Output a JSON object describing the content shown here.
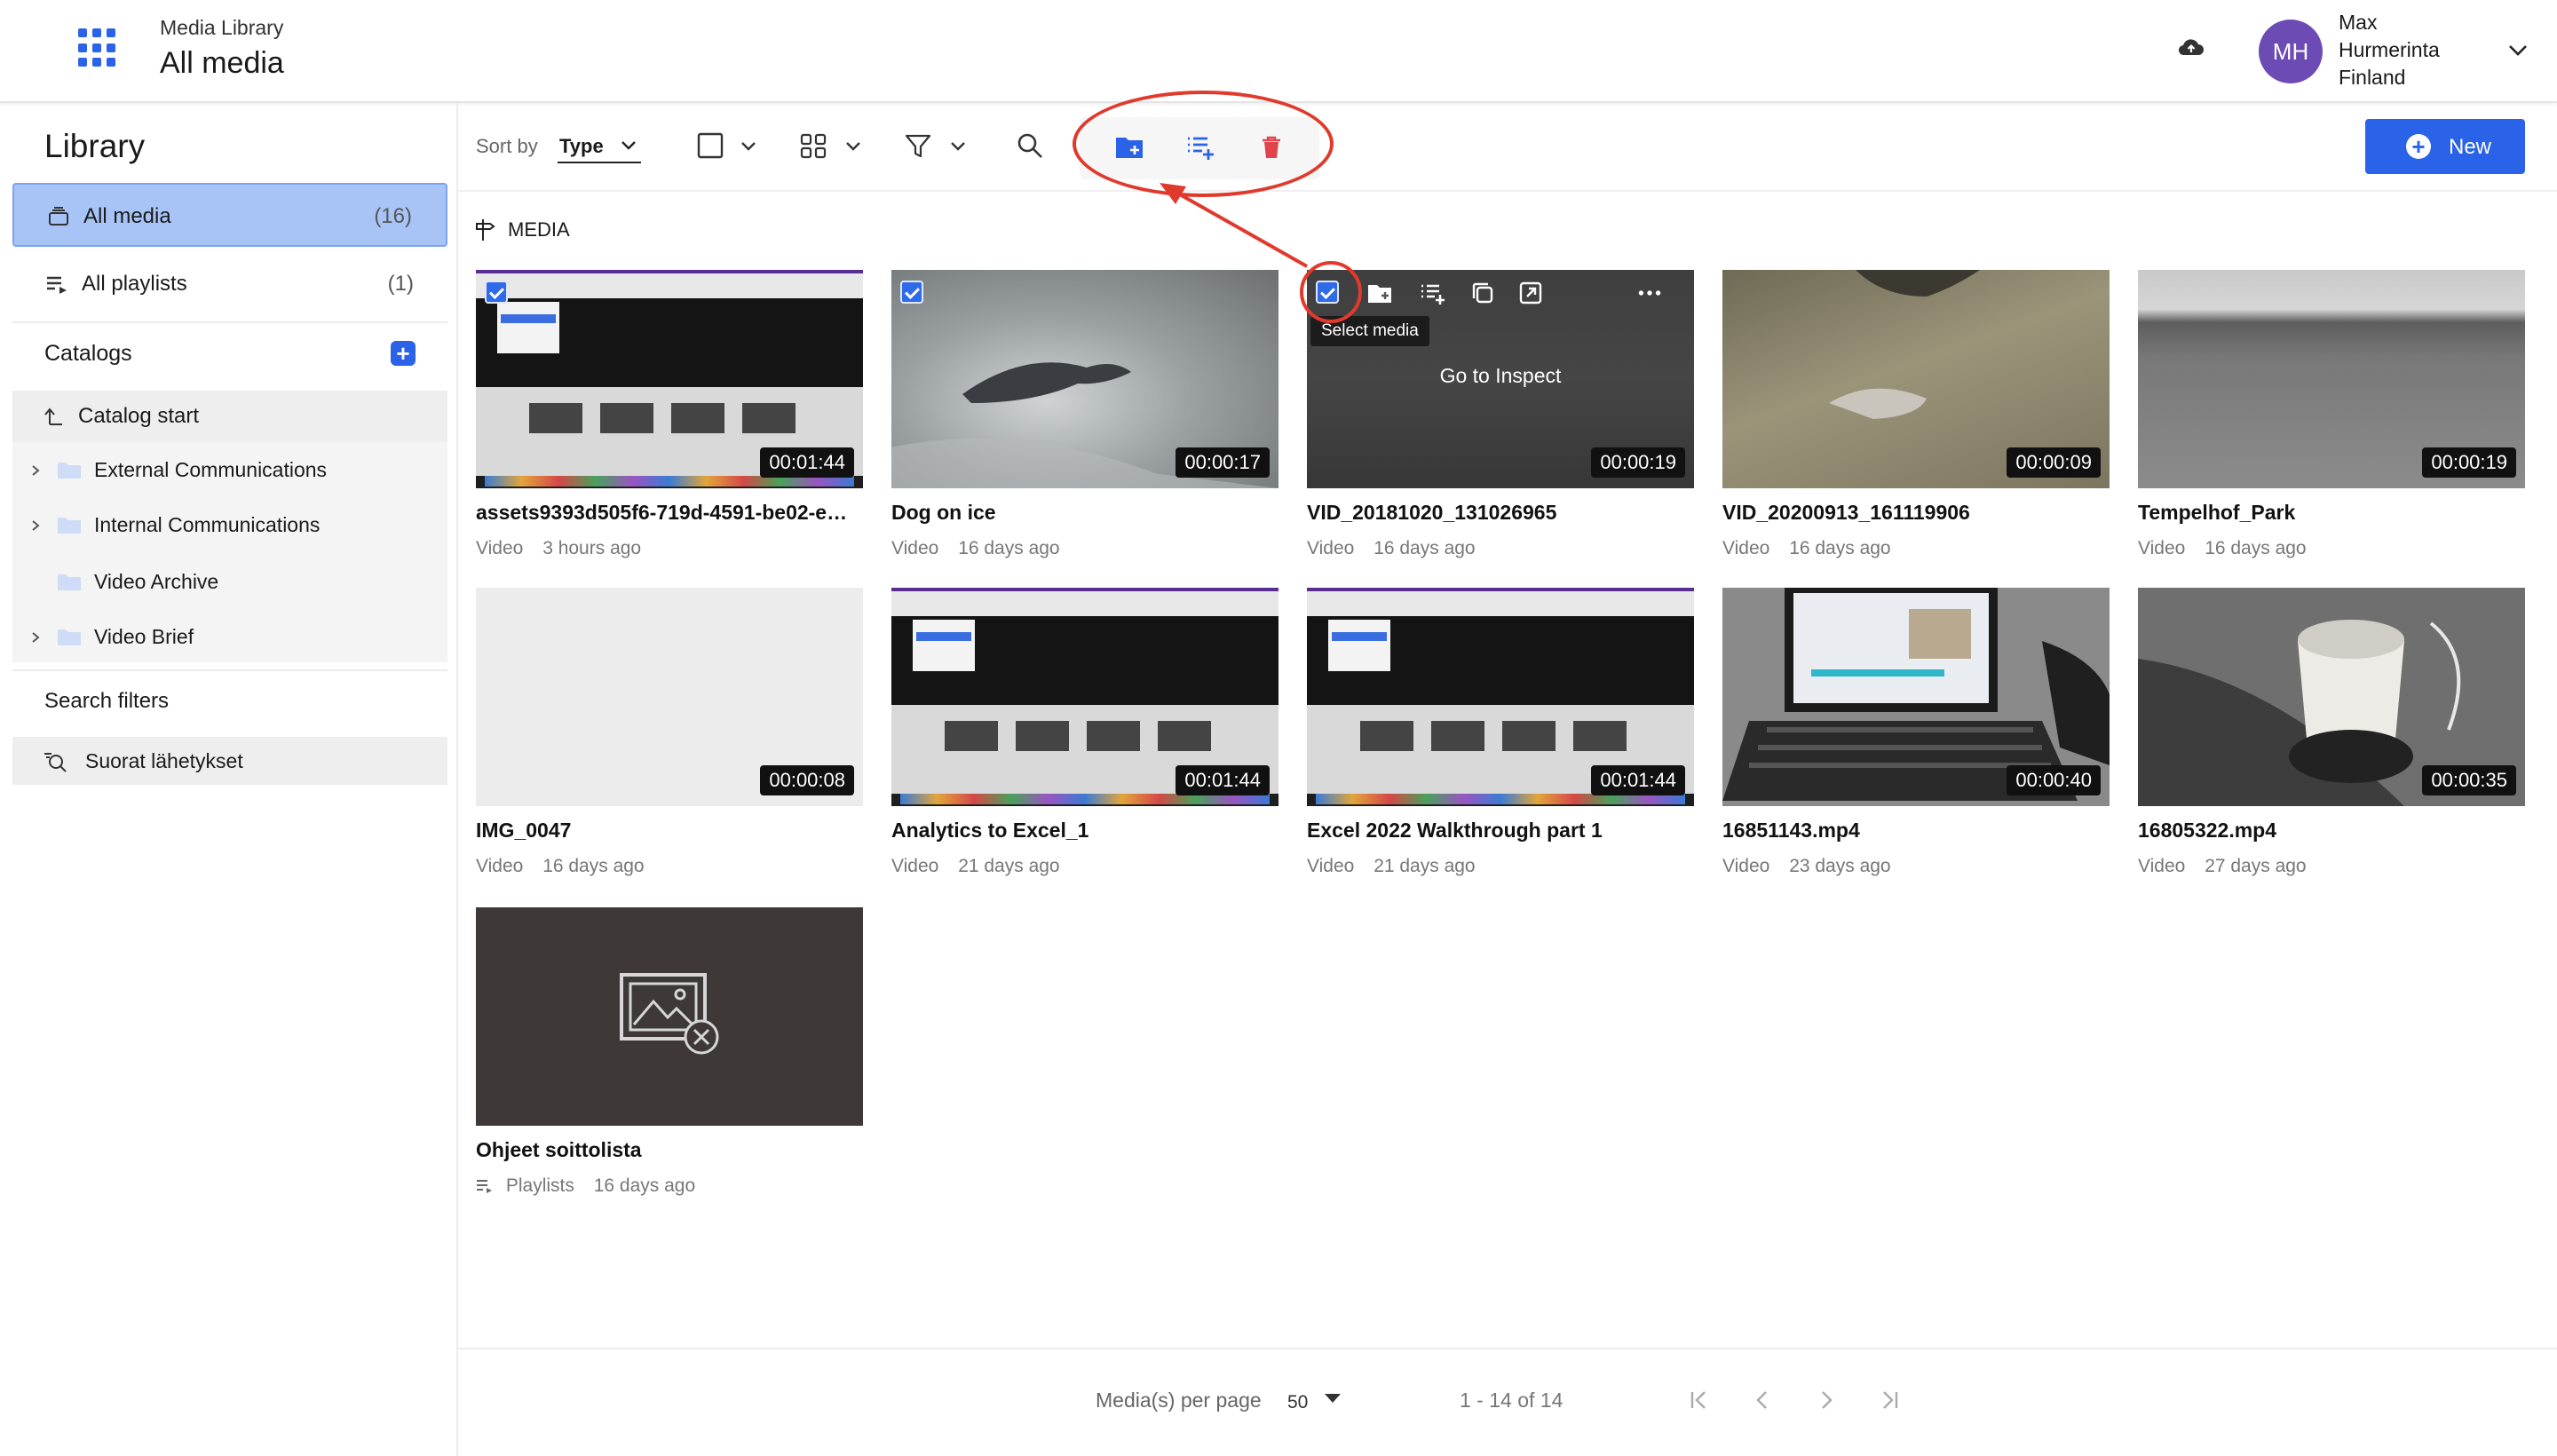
{
  "header": {
    "subtitle": "Media Library",
    "title": "All media",
    "user": {
      "initials": "MH",
      "name": "Max Hurmerinta Finland",
      "avatar_color": "#6d4bb4"
    }
  },
  "sidebar": {
    "title": "Library",
    "items": [
      {
        "label": "All media",
        "count": "(16)",
        "active": true
      },
      {
        "label": "All playlists",
        "count": "(1)",
        "active": false
      }
    ],
    "catalogs_label": "Catalogs",
    "catalog_start": "Catalog start",
    "catalogs": [
      {
        "label": "External Communications",
        "expandable": true
      },
      {
        "label": "Internal Communications",
        "expandable": true
      },
      {
        "label": "Video Archive",
        "expandable": false
      },
      {
        "label": "Video Brief",
        "expandable": true
      }
    ],
    "search_filters_label": "Search filters",
    "saved_search": "Suorat lähetykset"
  },
  "toolbar": {
    "sort_label": "Sort by",
    "sort_value": "Type",
    "new_label": "New",
    "accent_color": "#2a62e8",
    "delete_color": "#e0434b"
  },
  "section_label": "MEDIA",
  "media": [
    {
      "title": "assets9393d505f6-719d-4591-be02-e…",
      "type": "Video",
      "age": "3 hours ago",
      "duration": "00:01:44",
      "selected": true
    },
    {
      "title": "Dog on ice",
      "type": "Video",
      "age": "16 days ago",
      "duration": "00:00:17",
      "selected": true
    },
    {
      "title": "VID_20181020_131026965",
      "type": "Video",
      "age": "16 days ago",
      "duration": "00:00:19",
      "selected": true,
      "hover": true
    },
    {
      "title": "VID_20200913_161119906",
      "type": "Video",
      "age": "16 days ago",
      "duration": "00:00:09"
    },
    {
      "title": "Tempelhof_Park",
      "type": "Video",
      "age": "16 days ago",
      "duration": "00:00:19"
    },
    {
      "title": "IMG_0047",
      "type": "Video",
      "age": "16 days ago",
      "duration": "00:00:08"
    },
    {
      "title": "Analytics to Excel_1",
      "type": "Video",
      "age": "21 days ago",
      "duration": "00:01:44"
    },
    {
      "title": "Excel 2022 Walkthrough part 1",
      "type": "Video",
      "age": "21 days ago",
      "duration": "00:01:44"
    },
    {
      "title": "16851143.mp4",
      "type": "Video",
      "age": "23 days ago",
      "duration": "00:00:40"
    },
    {
      "title": "16805322.mp4",
      "type": "Video",
      "age": "27 days ago",
      "duration": "00:00:35"
    },
    {
      "title": "Ohjeet soittolista",
      "type": "Playlists",
      "age": "16 days ago"
    }
  ],
  "hover_card": {
    "tooltip": "Select media",
    "go_inspect": "Go to Inspect"
  },
  "pagination": {
    "per_page_label": "Media(s) per page",
    "per_page_value": "50",
    "range": "1 - 14 of 14"
  },
  "annotation_color": "#e03a2d"
}
